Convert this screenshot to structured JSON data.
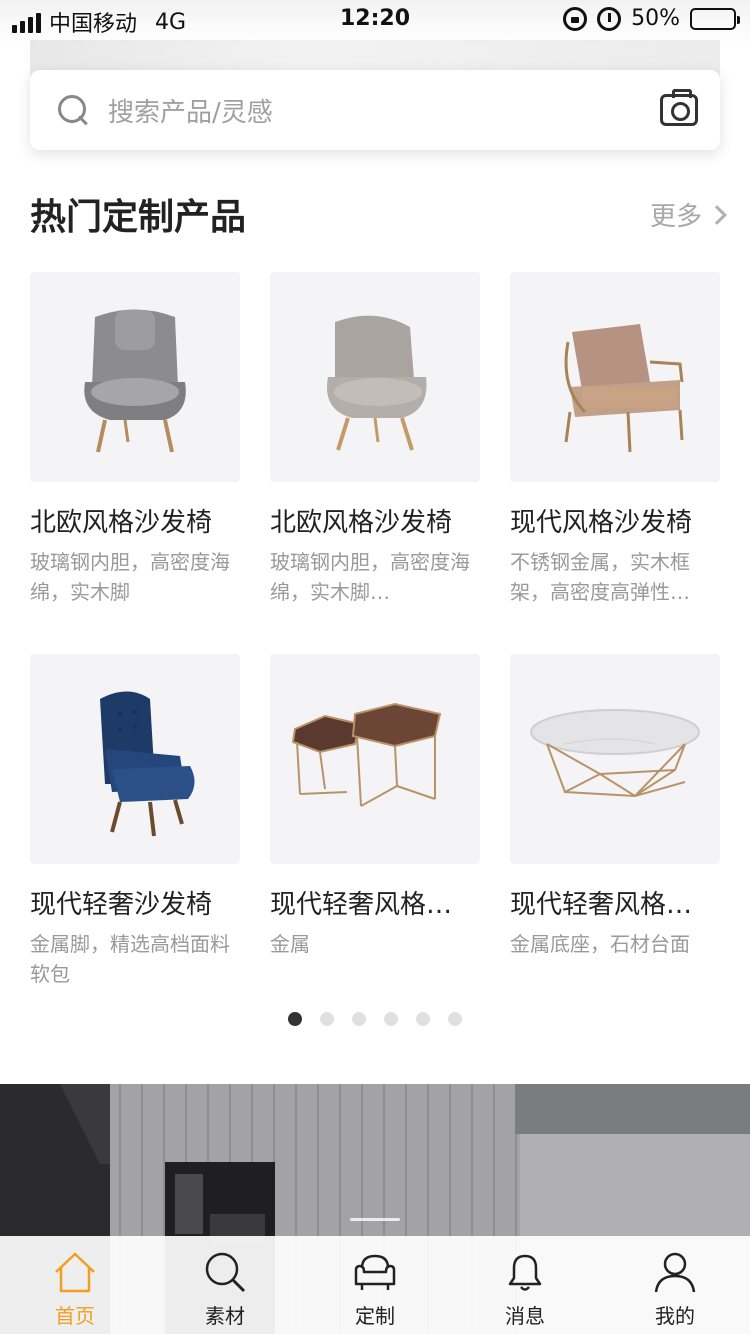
{
  "status_bar": {
    "carrier": "中国移动",
    "network": "4G",
    "time": "12:20",
    "battery_label": "50%",
    "battery_level": 0.5
  },
  "search": {
    "placeholder": "搜索产品/灵感",
    "search_icon": "search-icon",
    "camera_icon": "camera-icon"
  },
  "section": {
    "title": "热门定制产品",
    "more_label": "更多"
  },
  "products": [
    {
      "title": "北欧风格沙发椅",
      "desc": "玻璃钢内胆，高密度海绵，实木脚",
      "image": "grey-wingback-armchair"
    },
    {
      "title": "北欧风格沙发椅",
      "desc": "玻璃钢内胆，高密度海绵，实木脚…",
      "image": "beige-lounge-armchair"
    },
    {
      "title": "现代风格沙发椅",
      "desc": "不锈钢金属，实木框架，高密度高弹性…",
      "image": "tan-metal-frame-armchair"
    },
    {
      "title": "现代轻奢沙发椅",
      "desc": "金属脚，精选高档面料软包",
      "image": "navy-velvet-wingback-chair"
    },
    {
      "title": "现代轻奢风格…",
      "desc": "金属",
      "image": "hexagon-nesting-tables"
    },
    {
      "title": "现代轻奢风格…",
      "desc": "金属底座，石材台面",
      "image": "marble-round-coffee-table"
    }
  ],
  "pager": {
    "count": 6,
    "active": 0
  },
  "tabs": [
    {
      "label": "首页",
      "icon": "home-icon",
      "active": true
    },
    {
      "label": "素材",
      "icon": "search-icon",
      "active": false
    },
    {
      "label": "定制",
      "icon": "sofa-icon",
      "active": false
    },
    {
      "label": "消息",
      "icon": "bell-icon",
      "active": false
    },
    {
      "label": "我的",
      "icon": "user-icon",
      "active": false
    }
  ],
  "colors": {
    "accent": "#f0a020",
    "text_primary": "#222222",
    "text_secondary": "#9a9a9a"
  }
}
